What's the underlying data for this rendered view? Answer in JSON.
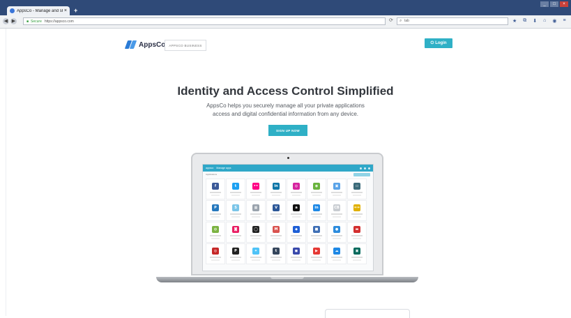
{
  "browser": {
    "tab_title": "AppsCo - Manage and share yo",
    "tab_close": "×",
    "new_tab": "+",
    "url_secure_label": "Secure",
    "url_text": "https://appsco.com",
    "search_text": "tab",
    "window_buttons": [
      "_",
      "□",
      "×"
    ],
    "nav": {
      "back": "◀",
      "forward": "▶",
      "reload": "⟳"
    },
    "toolbar_icons": [
      "★",
      "⧉",
      "⬇",
      "⌂",
      "◉",
      "≡"
    ]
  },
  "site": {
    "brand": "AppsCo",
    "business_button": "APPSCO BUSINESS",
    "login_button": "Login",
    "headline": "Identity and Access Control Simplified",
    "sub_line1": "AppsCo helps you securely manage all your private applications",
    "sub_line2": "access and digital confidential information from any device.",
    "signup_button": "SIGN UP NOW",
    "screen_app": {
      "brand": "appsco",
      "breadcrumb": "Manage apps",
      "toolbar_label": "Applications"
    }
  },
  "apps": [
    {
      "glyph": "f",
      "color": "#3b5998"
    },
    {
      "glyph": "t",
      "color": "#1da1f2"
    },
    {
      "glyph": "••",
      "color": "#ff0084"
    },
    {
      "glyph": "in",
      "color": "#0e76a8"
    },
    {
      "glyph": "◎",
      "color": "#d6249f"
    },
    {
      "glyph": "◉",
      "color": "#6ab43e"
    },
    {
      "glyph": "▣",
      "color": "#5aa3e8"
    },
    {
      "glyph": "▭",
      "color": "#3c6b7a"
    },
    {
      "glyph": "P",
      "color": "#2678bd"
    },
    {
      "glyph": "S",
      "color": "#7bc5e8"
    },
    {
      "glyph": "▦",
      "color": "#9aa3ad"
    },
    {
      "glyph": "V",
      "color": "#2b5797"
    },
    {
      "glyph": "a",
      "color": "#111111"
    },
    {
      "glyph": "in",
      "color": "#1e88e5"
    },
    {
      "glyph": "CB",
      "color": "#c8ccd1"
    },
    {
      "glyph": "==",
      "color": "#e0b000"
    },
    {
      "glyph": "◍",
      "color": "#7cb342"
    },
    {
      "glyph": "◙",
      "color": "#e91e63"
    },
    {
      "glyph": "◯",
      "color": "#222222"
    },
    {
      "glyph": "M",
      "color": "#d9534f"
    },
    {
      "glyph": "◆",
      "color": "#1e5fd6"
    },
    {
      "glyph": "■",
      "color": "#3f6fb5"
    },
    {
      "glyph": "●",
      "color": "#2d8cdd"
    },
    {
      "glyph": "▬",
      "color": "#d32f2f"
    },
    {
      "glyph": "◎",
      "color": "#c62828"
    },
    {
      "glyph": "P",
      "color": "#212121"
    },
    {
      "glyph": "✦",
      "color": "#4fc3f7"
    },
    {
      "glyph": "t",
      "color": "#35465c"
    },
    {
      "glyph": "◼",
      "color": "#3949ab"
    },
    {
      "glyph": "▶",
      "color": "#e53935"
    },
    {
      "glyph": "☁",
      "color": "#1e88e5"
    },
    {
      "glyph": "▣",
      "color": "#00695c"
    }
  ]
}
